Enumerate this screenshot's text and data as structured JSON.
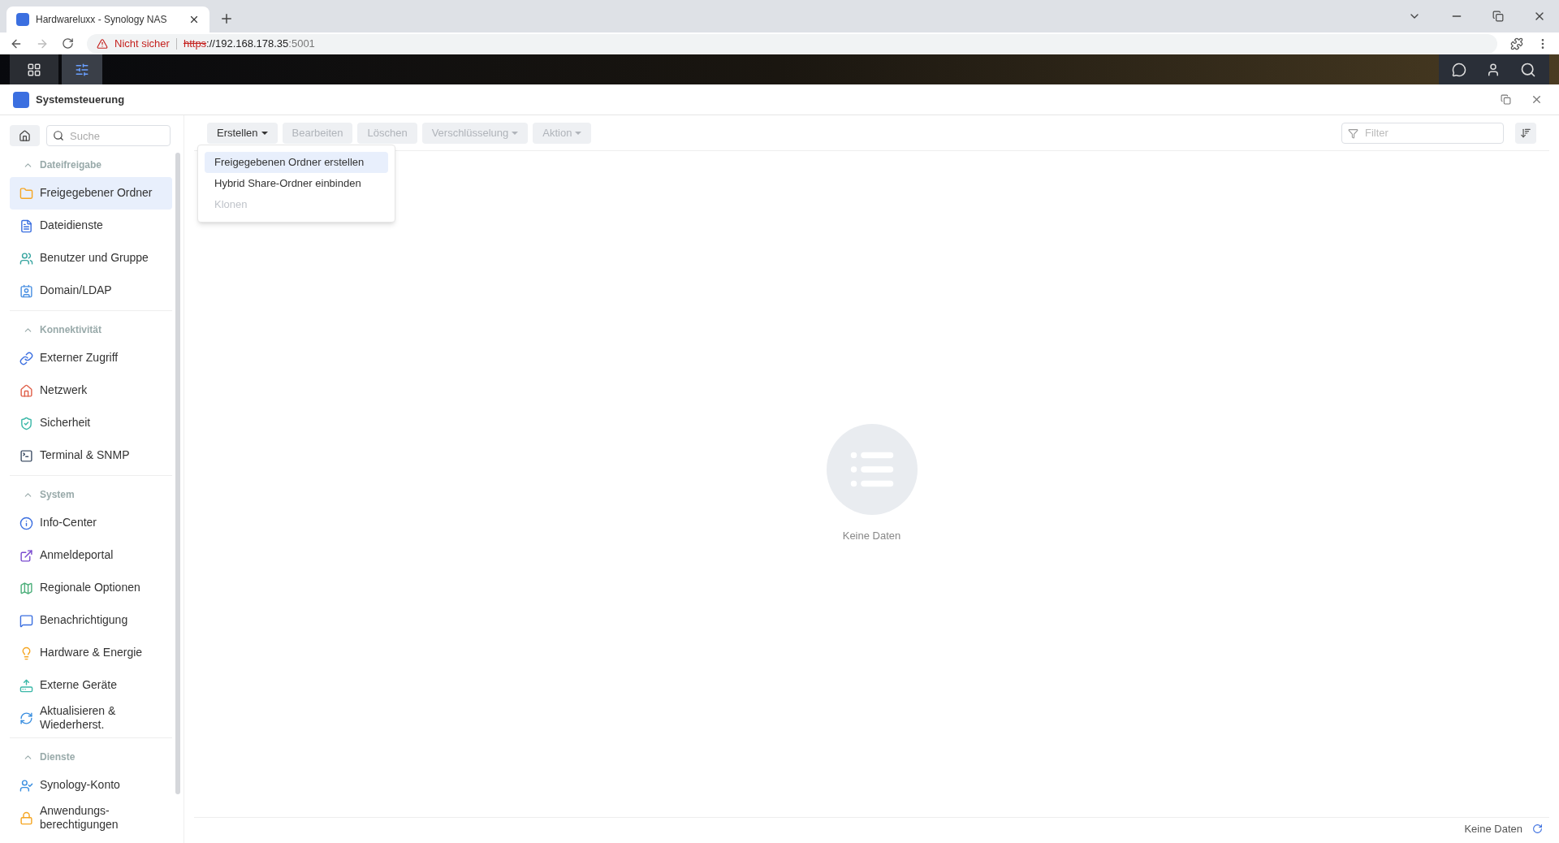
{
  "browser": {
    "tab_title": "Hardwareluxx - Synology NAS",
    "security": "Nicht sicher",
    "url_scheme": "https",
    "url_host": "://192.168.178.35",
    "url_port": ":5001"
  },
  "window": {
    "title": "Systemsteuerung"
  },
  "sidebar": {
    "search_placeholder": "Suche",
    "sections": [
      {
        "title": "Dateifreigabe",
        "expanded": true,
        "items": [
          {
            "label": "Freigegebener Ordner",
            "selected": true
          },
          {
            "label": "Dateidienste",
            "selected": false
          },
          {
            "label": "Benutzer und Gruppe",
            "selected": false
          },
          {
            "label": "Domain/LDAP",
            "selected": false
          }
        ]
      },
      {
        "title": "Konnektivität",
        "expanded": true,
        "items": [
          {
            "label": "Externer Zugriff",
            "selected": false
          },
          {
            "label": "Netzwerk",
            "selected": false
          },
          {
            "label": "Sicherheit",
            "selected": false
          },
          {
            "label": "Terminal & SNMP",
            "selected": false
          }
        ]
      },
      {
        "title": "System",
        "expanded": true,
        "items": [
          {
            "label": "Info-Center",
            "selected": false
          },
          {
            "label": "Anmeldeportal",
            "selected": false
          },
          {
            "label": "Regionale Optionen",
            "selected": false
          },
          {
            "label": "Benachrichtigung",
            "selected": false
          },
          {
            "label": "Hardware & Energie",
            "selected": false
          },
          {
            "label": "Externe Geräte",
            "selected": false
          },
          {
            "label": "Aktualisieren & Wiederherst.",
            "selected": false
          }
        ]
      },
      {
        "title": "Dienste",
        "expanded": true,
        "items": [
          {
            "label": "Synology-Konto",
            "selected": false
          },
          {
            "label": "Anwendungs-berechtigungen",
            "selected": false
          }
        ]
      }
    ]
  },
  "toolbar": {
    "buttons": [
      {
        "label": "Erstellen",
        "dropdown": true,
        "disabled": false
      },
      {
        "label": "Bearbeiten",
        "dropdown": false,
        "disabled": true
      },
      {
        "label": "Löschen",
        "dropdown": false,
        "disabled": true
      },
      {
        "label": "Verschlüsselung",
        "dropdown": true,
        "disabled": true
      },
      {
        "label": "Aktion",
        "dropdown": true,
        "disabled": true
      }
    ],
    "filter_placeholder": "Filter"
  },
  "menu": {
    "items": [
      {
        "label": "Freigegebenen Ordner erstellen",
        "selected": true,
        "disabled": false
      },
      {
        "label": "Hybrid Share-Ordner einbinden",
        "selected": false,
        "disabled": false
      },
      {
        "label": "Klonen",
        "selected": false,
        "disabled": true
      }
    ]
  },
  "empty_state": {
    "text": "Keine Daten"
  },
  "status_bar": {
    "text": "Keine Daten"
  }
}
